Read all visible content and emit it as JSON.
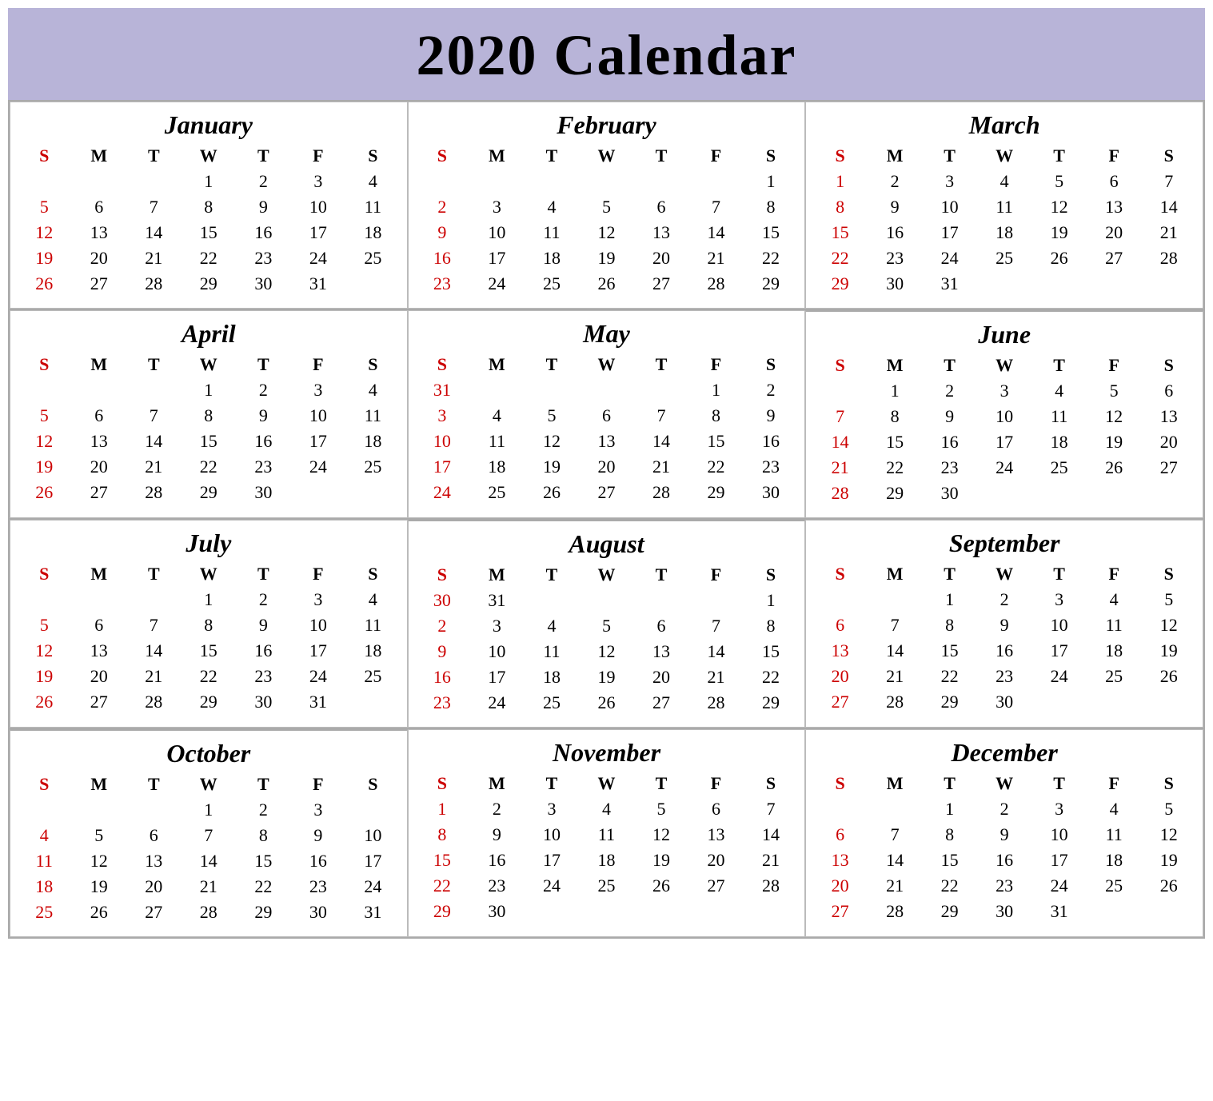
{
  "title": "2020 Calendar",
  "months": [
    {
      "name": "January",
      "weeks": [
        [
          "",
          "",
          "",
          "1",
          "2",
          "3",
          "4"
        ],
        [
          "5",
          "6",
          "7",
          "8",
          "9",
          "10",
          "11"
        ],
        [
          "12",
          "13",
          "14",
          "15",
          "16",
          "17",
          "18"
        ],
        [
          "19",
          "20",
          "21",
          "22",
          "23",
          "24",
          "25"
        ],
        [
          "26",
          "27",
          "28",
          "29",
          "30",
          "31",
          ""
        ]
      ]
    },
    {
      "name": "February",
      "weeks": [
        [
          "",
          "",
          "",
          "",
          "",
          "",
          "1"
        ],
        [
          "2",
          "3",
          "4",
          "5",
          "6",
          "7",
          "8"
        ],
        [
          "9",
          "10",
          "11",
          "12",
          "13",
          "14",
          "15"
        ],
        [
          "16",
          "17",
          "18",
          "19",
          "20",
          "21",
          "22"
        ],
        [
          "23",
          "24",
          "25",
          "26",
          "27",
          "28",
          "29"
        ]
      ]
    },
    {
      "name": "March",
      "weeks": [
        [
          "1",
          "2",
          "3",
          "4",
          "5",
          "6",
          "7"
        ],
        [
          "8",
          "9",
          "10",
          "11",
          "12",
          "13",
          "14"
        ],
        [
          "15",
          "16",
          "17",
          "18",
          "19",
          "20",
          "21"
        ],
        [
          "22",
          "23",
          "24",
          "25",
          "26",
          "27",
          "28"
        ],
        [
          "29",
          "30",
          "31",
          "",
          "",
          "",
          ""
        ]
      ]
    },
    {
      "name": "April",
      "weeks": [
        [
          "",
          "",
          "",
          "1",
          "2",
          "3",
          "4"
        ],
        [
          "5",
          "6",
          "7",
          "8",
          "9",
          "10",
          "11"
        ],
        [
          "12",
          "13",
          "14",
          "15",
          "16",
          "17",
          "18"
        ],
        [
          "19",
          "20",
          "21",
          "22",
          "23",
          "24",
          "25"
        ],
        [
          "26",
          "27",
          "28",
          "29",
          "30",
          "",
          ""
        ]
      ]
    },
    {
      "name": "May",
      "weeks": [
        [
          "31",
          "",
          "",
          "",
          "",
          "1",
          "2"
        ],
        [
          "3",
          "4",
          "5",
          "6",
          "7",
          "8",
          "9"
        ],
        [
          "10",
          "11",
          "12",
          "13",
          "14",
          "15",
          "16"
        ],
        [
          "17",
          "18",
          "19",
          "20",
          "21",
          "22",
          "23"
        ],
        [
          "24",
          "25",
          "26",
          "27",
          "28",
          "29",
          "30"
        ]
      ]
    },
    {
      "name": "June",
      "weeks": [
        [
          "",
          "1",
          "2",
          "3",
          "4",
          "5",
          "6"
        ],
        [
          "7",
          "8",
          "9",
          "10",
          "11",
          "12",
          "13"
        ],
        [
          "14",
          "15",
          "16",
          "17",
          "18",
          "19",
          "20"
        ],
        [
          "21",
          "22",
          "23",
          "24",
          "25",
          "26",
          "27"
        ],
        [
          "28",
          "29",
          "30",
          "",
          "",
          "",
          ""
        ]
      ]
    },
    {
      "name": "July",
      "weeks": [
        [
          "",
          "",
          "",
          "1",
          "2",
          "3",
          "4"
        ],
        [
          "5",
          "6",
          "7",
          "8",
          "9",
          "10",
          "11"
        ],
        [
          "12",
          "13",
          "14",
          "15",
          "16",
          "17",
          "18"
        ],
        [
          "19",
          "20",
          "21",
          "22",
          "23",
          "24",
          "25"
        ],
        [
          "26",
          "27",
          "28",
          "29",
          "30",
          "31",
          ""
        ]
      ]
    },
    {
      "name": "August",
      "weeks": [
        [
          "30",
          "31",
          "",
          "",
          "",
          "",
          "1"
        ],
        [
          "2",
          "3",
          "4",
          "5",
          "6",
          "7",
          "8"
        ],
        [
          "9",
          "10",
          "11",
          "12",
          "13",
          "14",
          "15"
        ],
        [
          "16",
          "17",
          "18",
          "19",
          "20",
          "21",
          "22"
        ],
        [
          "23",
          "24",
          "25",
          "26",
          "27",
          "28",
          "29"
        ]
      ]
    },
    {
      "name": "September",
      "weeks": [
        [
          "",
          "",
          "1",
          "2",
          "3",
          "4",
          "5"
        ],
        [
          "6",
          "7",
          "8",
          "9",
          "10",
          "11",
          "12"
        ],
        [
          "13",
          "14",
          "15",
          "16",
          "17",
          "18",
          "19"
        ],
        [
          "20",
          "21",
          "22",
          "23",
          "24",
          "25",
          "26"
        ],
        [
          "27",
          "28",
          "29",
          "30",
          "",
          "",
          ""
        ]
      ]
    },
    {
      "name": "October",
      "weeks": [
        [
          "",
          "",
          "",
          "1",
          "2",
          "3",
          ""
        ],
        [
          "4",
          "5",
          "6",
          "7",
          "8",
          "9",
          "10"
        ],
        [
          "11",
          "12",
          "13",
          "14",
          "15",
          "16",
          "17"
        ],
        [
          "18",
          "19",
          "20",
          "21",
          "22",
          "23",
          "24"
        ],
        [
          "25",
          "26",
          "27",
          "28",
          "29",
          "30",
          "31"
        ]
      ]
    },
    {
      "name": "November",
      "weeks": [
        [
          "1",
          "2",
          "3",
          "4",
          "5",
          "6",
          "7"
        ],
        [
          "8",
          "9",
          "10",
          "11",
          "12",
          "13",
          "14"
        ],
        [
          "15",
          "16",
          "17",
          "18",
          "19",
          "20",
          "21"
        ],
        [
          "22",
          "23",
          "24",
          "25",
          "26",
          "27",
          "28"
        ],
        [
          "29",
          "30",
          "",
          "",
          "",
          "",
          ""
        ]
      ]
    },
    {
      "name": "December",
      "weeks": [
        [
          "",
          "",
          "1",
          "2",
          "3",
          "4",
          "5"
        ],
        [
          "6",
          "7",
          "8",
          "9",
          "10",
          "11",
          "12"
        ],
        [
          "13",
          "14",
          "15",
          "16",
          "17",
          "18",
          "19"
        ],
        [
          "20",
          "21",
          "22",
          "23",
          "24",
          "25",
          "26"
        ],
        [
          "27",
          "28",
          "29",
          "30",
          "31",
          "",
          ""
        ]
      ]
    }
  ],
  "days": [
    "S",
    "M",
    "T",
    "W",
    "T",
    "F",
    "S"
  ],
  "sunday_red_months": {
    "january": [
      "5",
      "12",
      "19",
      "26"
    ],
    "february": [
      "2",
      "9",
      "16",
      "23"
    ],
    "march": [
      "1",
      "8",
      "15",
      "22",
      "29"
    ],
    "april": [
      "5",
      "12",
      "19",
      "26"
    ],
    "may": [
      "31",
      "3",
      "10",
      "17",
      "24"
    ],
    "june": [
      "7",
      "14",
      "21",
      "28"
    ],
    "july": [
      "5",
      "12",
      "19",
      "26"
    ],
    "august": [
      "30",
      "2",
      "9",
      "16",
      "23"
    ],
    "september": [
      "6",
      "13",
      "20",
      "27"
    ],
    "october": [
      "4",
      "11",
      "18",
      "25"
    ],
    "november": [
      "1",
      "8",
      "15",
      "22",
      "29"
    ],
    "december": [
      "6",
      "13",
      "20",
      "27"
    ]
  }
}
